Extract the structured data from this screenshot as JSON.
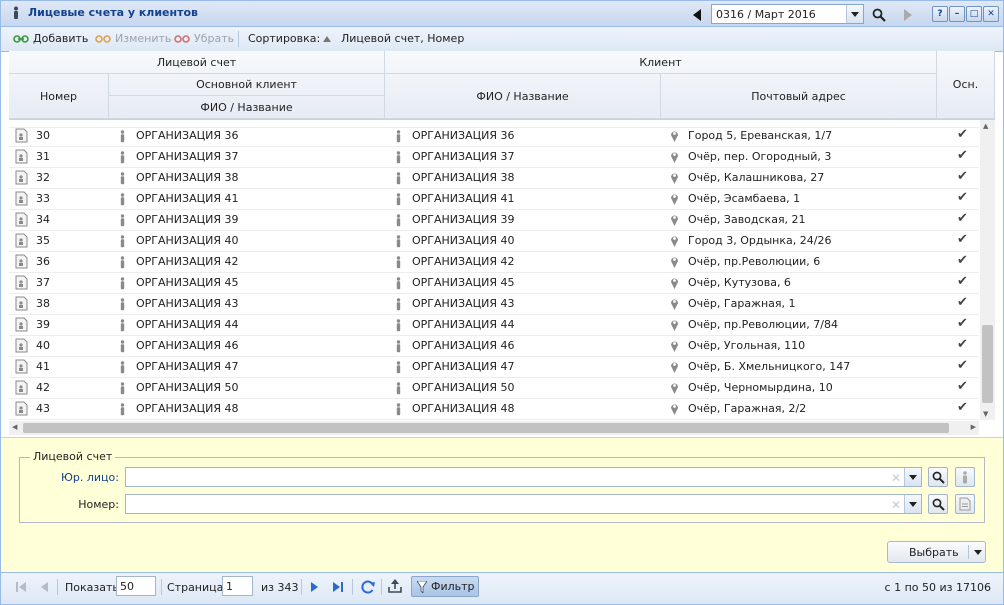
{
  "window": {
    "title": "Лицевые счета у клиентов",
    "period": "0316 / Март 2016"
  },
  "toolbar": {
    "add_label": "Добавить",
    "edit_label": "Изменить",
    "remove_label": "Убрать",
    "sort_label": "Сортировка:",
    "sort_value": "Лицевой счет, Номер"
  },
  "grid": {
    "headers": {
      "account_group": "Лицевой счет",
      "client_group": "Клиент",
      "number": "Номер",
      "main_client": "Основной клиент",
      "main_client_name": "ФИО / Название",
      "client_name": "ФИО / Название",
      "postal_address": "Почтовый адрес",
      "main": "Осн."
    },
    "rows": [
      {
        "number": "30",
        "main_client": "ОРГАНИЗАЦИЯ 36",
        "client": "ОРГАНИЗАЦИЯ 36",
        "address": "Город 5, Ереванская, 1/7",
        "main": "✔"
      },
      {
        "number": "31",
        "main_client": "ОРГАНИЗАЦИЯ 37",
        "client": "ОРГАНИЗАЦИЯ 37",
        "address": "Очёр, пер. Огородный, 3",
        "main": "✔"
      },
      {
        "number": "32",
        "main_client": "ОРГАНИЗАЦИЯ 38",
        "client": "ОРГАНИЗАЦИЯ 38",
        "address": "Очёр, Калашникова, 27",
        "main": "✔"
      },
      {
        "number": "33",
        "main_client": "ОРГАНИЗАЦИЯ 41",
        "client": "ОРГАНИЗАЦИЯ 41",
        "address": "Очёр, Эсамбаева, 1",
        "main": "✔"
      },
      {
        "number": "34",
        "main_client": "ОРГАНИЗАЦИЯ 39",
        "client": "ОРГАНИЗАЦИЯ 39",
        "address": "Очёр, Заводская, 21",
        "main": "✔"
      },
      {
        "number": "35",
        "main_client": "ОРГАНИЗАЦИЯ 40",
        "client": "ОРГАНИЗАЦИЯ 40",
        "address": "Город 3, Ордынка, 24/26",
        "main": "✔"
      },
      {
        "number": "36",
        "main_client": "ОРГАНИЗАЦИЯ 42",
        "client": "ОРГАНИЗАЦИЯ 42",
        "address": "Очёр, пр.Революции, 6",
        "main": "✔"
      },
      {
        "number": "37",
        "main_client": "ОРГАНИЗАЦИЯ 45",
        "client": "ОРГАНИЗАЦИЯ 45",
        "address": "Очёр, Кутузова, 6",
        "main": "✔"
      },
      {
        "number": "38",
        "main_client": "ОРГАНИЗАЦИЯ 43",
        "client": "ОРГАНИЗАЦИЯ 43",
        "address": "Очёр, Гаражная, 1",
        "main": "✔"
      },
      {
        "number": "39",
        "main_client": "ОРГАНИЗАЦИЯ 44",
        "client": "ОРГАНИЗАЦИЯ 44",
        "address": "Очёр, пр.Революции, 7/84",
        "main": "✔"
      },
      {
        "number": "40",
        "main_client": "ОРГАНИЗАЦИЯ 46",
        "client": "ОРГАНИЗАЦИЯ 46",
        "address": "Очёр, Угольная, 110",
        "main": "✔"
      },
      {
        "number": "41",
        "main_client": "ОРГАНИЗАЦИЯ 47",
        "client": "ОРГАНИЗАЦИЯ 47",
        "address": "Очёр, Б. Хмельницкого, 147",
        "main": "✔"
      },
      {
        "number": "42",
        "main_client": "ОРГАНИЗАЦИЯ 50",
        "client": "ОРГАНИЗАЦИЯ 50",
        "address": "Очёр, Черномырдина, 10",
        "main": "✔"
      },
      {
        "number": "43",
        "main_client": "ОРГАНИЗАЦИЯ 48",
        "client": "ОРГАНИЗАЦИЯ 48",
        "address": "Очёр, Гаражная, 2/2",
        "main": "✔"
      }
    ]
  },
  "filter": {
    "legend": "Лицевой счет",
    "legal_entity_label": "Юр. лицо:",
    "legal_entity_value": "",
    "number_label": "Номер:",
    "number_value": "",
    "select_button": "Выбрать"
  },
  "pager": {
    "show_label": "Показать",
    "page_size": "50",
    "page_label": "Страница",
    "page_value": "1",
    "of_pages": "из 343",
    "filter_label": "Фильтр",
    "summary": "с 1 по 50 из 17106"
  },
  "colors": {
    "title_text": "#15428b",
    "header_bg": "#dfe8f6",
    "filter_bg": "#ffffd8",
    "label_blue": "#15428b"
  }
}
